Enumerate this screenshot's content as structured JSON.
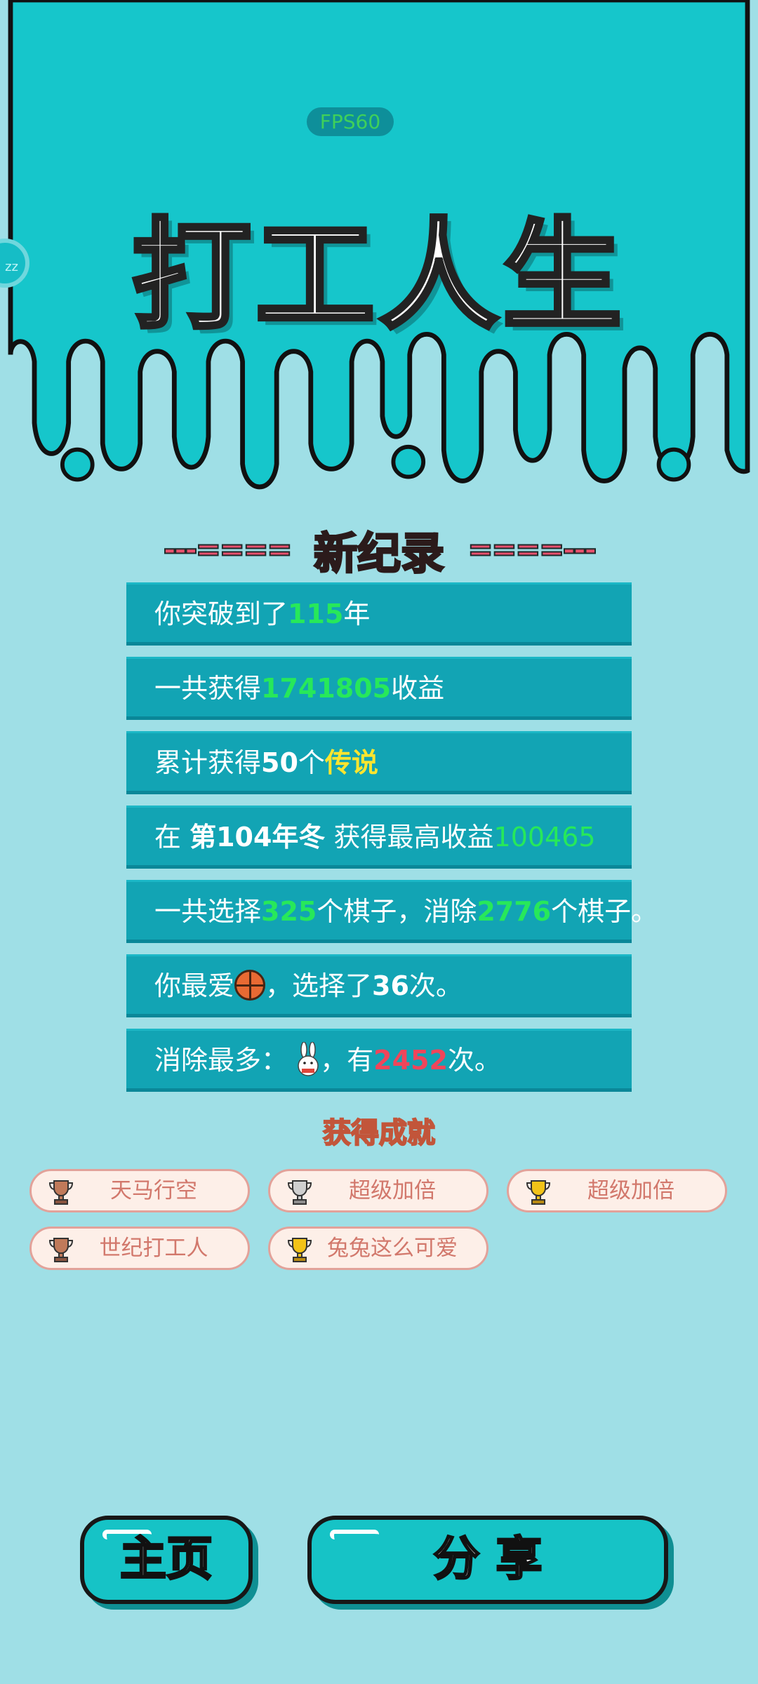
{
  "fps_label": "FPS60",
  "side_badge": "zz",
  "title": "打工人生",
  "record": {
    "left_deco": "---====",
    "word": "新纪录",
    "right_deco": "====---"
  },
  "stats": {
    "years": {
      "pre": "你突破到了",
      "num": "115",
      "post": "年"
    },
    "income": {
      "pre": "一共获得",
      "num": "1741805",
      "post": "收益"
    },
    "legend": {
      "pre": "累计获得",
      "num": "50",
      "mid": "个",
      "tag": "传说"
    },
    "best": {
      "pre": "在 ",
      "season": "第104年冬",
      "mid": " 获得最高收益",
      "num": "100465"
    },
    "pieces": {
      "pre": "一共选择",
      "num1": "325",
      "mid": "个棋子，消除",
      "num2": "2776",
      "post": "个棋子。"
    },
    "favorite": {
      "pre": "你最爱",
      "icon": "basketball-icon",
      "mid": "，选择了",
      "num": "36",
      "post": "次。"
    },
    "eliminated": {
      "pre": "消除最多：",
      "icon": "rabbit-icon",
      "mid": "，有",
      "num": "2452",
      "post": "次。"
    }
  },
  "achievements_title": "获得成就",
  "achievements": [
    {
      "label": "天马行空",
      "trophy": "bronze"
    },
    {
      "label": "超级加倍",
      "trophy": "silver"
    },
    {
      "label": "超级加倍",
      "trophy": "gold"
    },
    {
      "label": "世纪打工人",
      "trophy": "bronze"
    },
    {
      "label": "兔兔这么可爱",
      "trophy": "gold"
    }
  ],
  "buttons": {
    "home": "主页",
    "share": "分 享"
  },
  "colors": {
    "top_band": "#16c6cb",
    "bottom_bg": "#9fdfe6",
    "stat_bar": "#12a4b4",
    "highlight_green": "#27e85a",
    "highlight_yellow": "#ffe52e",
    "highlight_red": "#f0455a",
    "record_pink": "#f0547a"
  }
}
